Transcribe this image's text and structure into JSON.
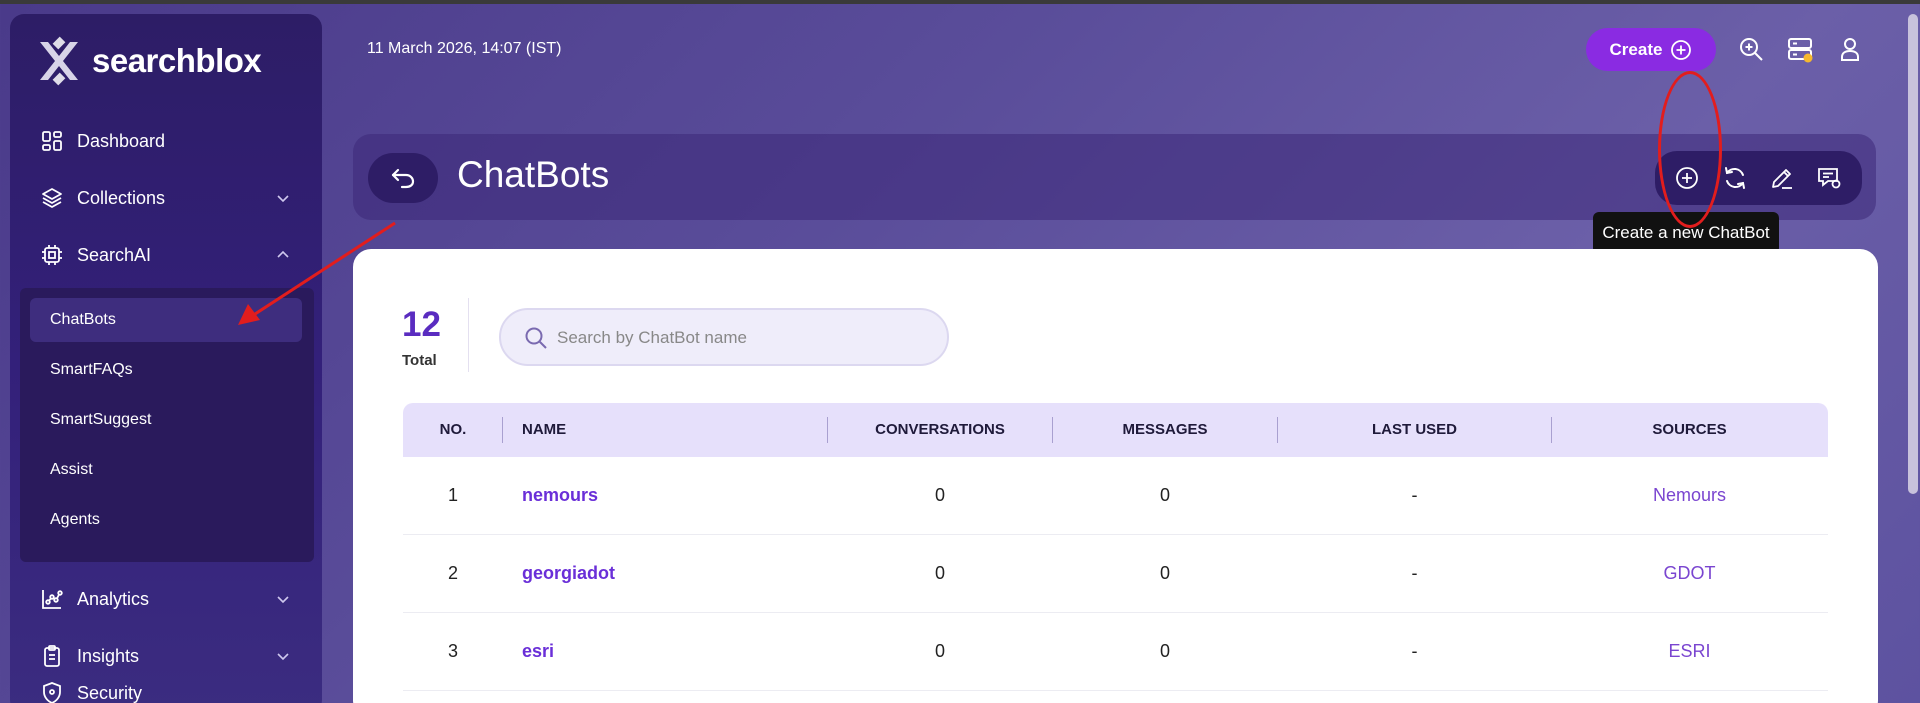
{
  "brand": {
    "name": "searchblox"
  },
  "header": {
    "datetime": "11 March 2026, 14:07 (IST)",
    "create_label": "Create"
  },
  "sidebar": {
    "items": [
      {
        "label": "Dashboard",
        "icon": "dashboard-icon"
      },
      {
        "label": "Collections",
        "icon": "layers-icon",
        "expandable": true
      },
      {
        "label": "SearchAI",
        "icon": "chip-icon",
        "expanded": true
      }
    ],
    "searchai_sub": [
      "ChatBots",
      "SmartFAQs",
      "SmartSuggest",
      "Assist",
      "Agents"
    ],
    "active_sub": "ChatBots",
    "lower_items": [
      {
        "label": "Analytics",
        "icon": "analytics-icon"
      },
      {
        "label": "Insights",
        "icon": "clipboard-icon"
      },
      {
        "label": "Security",
        "icon": "shield-icon"
      }
    ]
  },
  "page": {
    "title": "ChatBots",
    "tooltip": "Create a new ChatBot",
    "total_count": "12",
    "total_label": "Total",
    "search_placeholder": "Search by ChatBot name"
  },
  "table": {
    "columns": [
      "NO.",
      "NAME",
      "CONVERSATIONS",
      "MESSAGES",
      "LAST USED",
      "SOURCES"
    ],
    "rows": [
      {
        "no": "1",
        "name": "nemours",
        "conversations": "0",
        "messages": "0",
        "last_used": "-",
        "sources": "Nemours"
      },
      {
        "no": "2",
        "name": "georgiadot",
        "conversations": "0",
        "messages": "0",
        "last_used": "-",
        "sources": "GDOT"
      },
      {
        "no": "3",
        "name": "esri",
        "conversations": "0",
        "messages": "0",
        "last_used": "-",
        "sources": "ESRI"
      }
    ]
  },
  "colors": {
    "accent": "#8a2be2",
    "sidebar": "#2d1d66",
    "annotation_red": "#e21d1d",
    "link_purple": "#6a2fd8"
  }
}
